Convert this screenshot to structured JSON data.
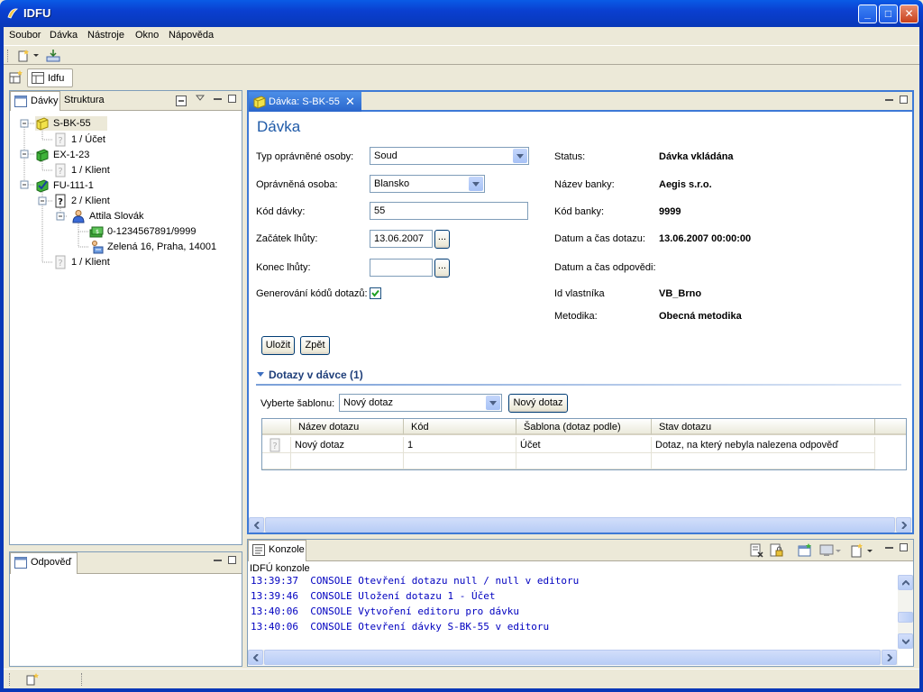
{
  "window": {
    "title": "IDFU"
  },
  "menu": [
    "Soubor",
    "Dávka",
    "Nástroje",
    "Okno",
    "Nápověda"
  ],
  "perspective": {
    "label": "Idfu"
  },
  "left_panel": {
    "tabs": [
      "Dávky",
      "Struktura"
    ],
    "tree": [
      {
        "label": "S-BK-55",
        "icon": "batch-yellow-icon"
      },
      {
        "label": "1 / Účet",
        "icon": "query-unknown-icon"
      },
      {
        "label": "EX-1-23",
        "icon": "batch-green-icon"
      },
      {
        "label": "1 / Klient",
        "icon": "query-unknown-icon"
      },
      {
        "label": "FU-111-1",
        "icon": "batch-check-icon"
      },
      {
        "label": "2 / Klient",
        "icon": "query-answered-icon"
      },
      {
        "label": "Attila Slovák",
        "icon": "person-icon"
      },
      {
        "label": "0-1234567891/9999",
        "icon": "account-icon"
      },
      {
        "label": "Zelená 16, Praha, 14001",
        "icon": "address-icon"
      },
      {
        "label": "1 / Klient",
        "icon": "query-unknown-icon"
      }
    ]
  },
  "answer_panel": {
    "tab": "Odpověď"
  },
  "editor": {
    "tab": "Dávka: S-BK-55",
    "title": "Dávka",
    "form": {
      "typ_label": "Typ oprávněné osoby:",
      "typ_value": "Soud",
      "osoba_label": "Oprávněná osoba:",
      "osoba_value": "Blansko",
      "kod_label": "Kód dávky:",
      "kod_value": "55",
      "zacatek_label": "Začátek lhůty:",
      "zacatek_value": "13.06.2007",
      "konec_label": "Konec lhůty:",
      "konec_value": "",
      "gen_label": "Generování kódů dotazů:",
      "gen_checked": true,
      "ellipsis": "..."
    },
    "info": {
      "status_label": "Status:",
      "status_value": "Dávka vkládána",
      "banka_label": "Název banky:",
      "banka_value": "Aegis s.r.o.",
      "kodbanky_label": "Kód banky:",
      "kodbanky_value": "9999",
      "datum_label": "Datum a čas dotazu:",
      "datum_value": "13.06.2007 00:00:00",
      "odpoved_label": "Datum a čas odpovědi:",
      "odpoved_value": "",
      "vlastnik_label": "Id vlastníka",
      "vlastnik_value": "VB_Brno",
      "metodika_label": "Metodika:",
      "metodika_value": "Obecná metodika"
    },
    "buttons": {
      "save": "Uložit",
      "back": "Zpět"
    },
    "section": {
      "title": "Dotazy v dávce (1)",
      "template_label": "Vyberte šablonu:",
      "template_value": "Nový dotaz",
      "new_button": "Nový dotaz",
      "columns": [
        "Název dotazu",
        "Kód",
        "Šablona (dotaz podle)",
        "Stav dotazu"
      ],
      "rows": [
        [
          "Nový dotaz",
          "1",
          "Účet",
          "Dotaz, na který nebyla nalezena odpověď"
        ]
      ]
    }
  },
  "console": {
    "tab": "Konzole",
    "title": "IDFÚ konzole",
    "lines": [
      "13:39:37  CONSOLE Otevření dotazu null / null v editoru",
      "13:39:46  CONSOLE Uložení dotazu 1 - Účet",
      "13:40:06  CONSOLE Vytvoření editoru pro dávku",
      "13:40:06  CONSOLE Otevření dávky S-BK-55 v editoru"
    ]
  },
  "colors": {
    "accent": "#0a5be6",
    "editor_title": "#1f5aa8",
    "console_text": "#0000c0"
  }
}
